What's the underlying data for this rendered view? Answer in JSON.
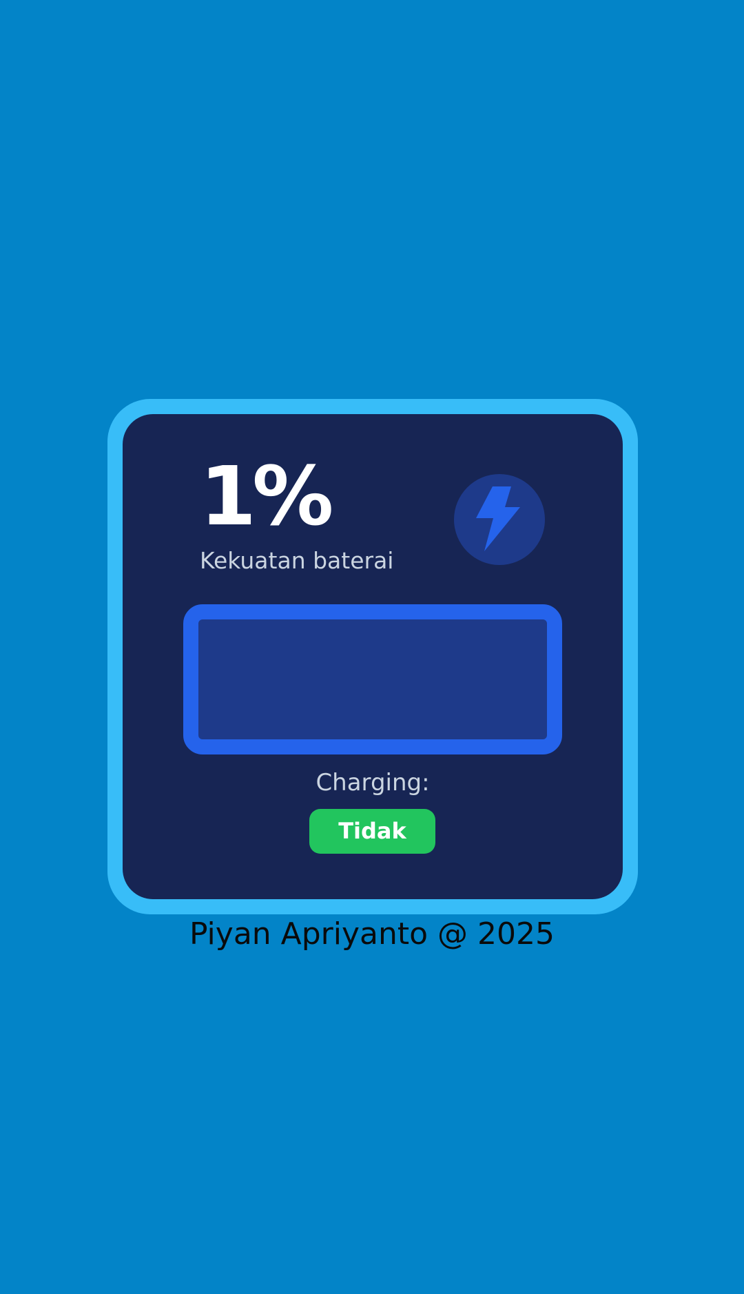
{
  "battery": {
    "percent_text": "1%",
    "level_percent": 1,
    "label": "Kekuatan baterai",
    "fill_color": "#22c55e"
  },
  "charging": {
    "label": "Charging:",
    "status": "Tidak"
  },
  "footer": {
    "text": "Piyan Apriyanto @ 2025"
  },
  "icons": {
    "status_icon": "lightning-bolt-icon"
  },
  "colors": {
    "background": "#0384c8",
    "card_border": "#38bdf8",
    "card": "#172554",
    "battery_border": "#2563eb",
    "battery_empty": "#1e3a8a",
    "bolt": "#2563eb",
    "status_badge": "#22c55e"
  }
}
